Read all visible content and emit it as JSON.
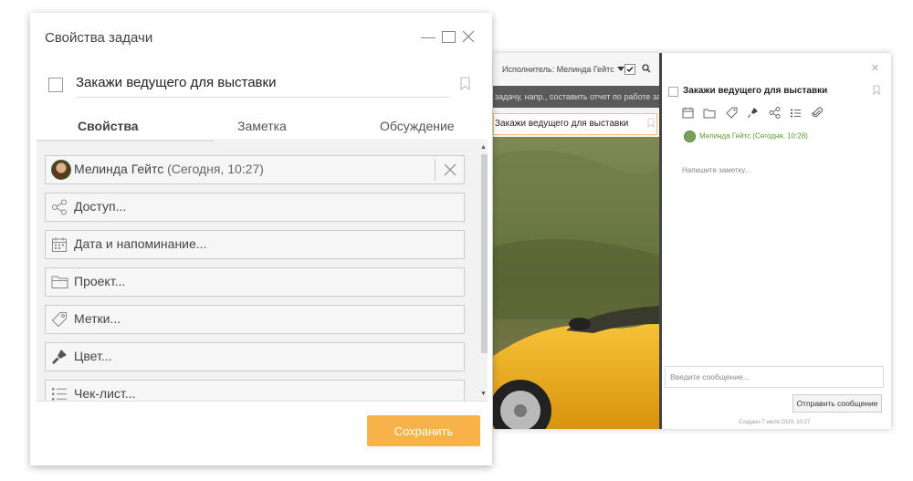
{
  "background_app": {
    "filter": {
      "assignee_label": "Исполнитель: Мелинда Гейтс"
    },
    "new_task_placeholder": "задачу, напр., составить отчет по работе за п",
    "selected_task": "Закажи ведущего для выставки",
    "detail": {
      "title": "Закажи ведущего для выставки",
      "author": "Мелинда Гейтс",
      "author_time": "(Сегодня, 10:28)",
      "note_placeholder": "Напишите заметку...",
      "message_placeholder": "Введите сообщение...",
      "send_button": "Отправить сообщение",
      "created": "Создано 7 июля 2020, 10:27"
    },
    "icons": [
      "calendar-icon",
      "folder-icon",
      "tag-icon",
      "paint-brush-icon",
      "share-icon",
      "checklist-icon",
      "paperclip-icon"
    ]
  },
  "dialog": {
    "title": "Свойства задачи",
    "task_name": "Закажи ведущего для выставки",
    "tabs": [
      {
        "label": "Свойства",
        "active": true
      },
      {
        "label": "Заметка",
        "active": false
      },
      {
        "label": "Обсуждение",
        "active": false
      }
    ],
    "owner": {
      "name": "Мелинда Гейтс",
      "time": "(Сегодня, 10:27)"
    },
    "properties": [
      {
        "label": "Доступ...",
        "icon": "share-icon"
      },
      {
        "label": "Дата и напоминание...",
        "icon": "calendar-icon"
      },
      {
        "label": "Проект...",
        "icon": "folder-icon"
      },
      {
        "label": "Метки...",
        "icon": "tag-icon"
      },
      {
        "label": "Цвет...",
        "icon": "paint-brush-icon"
      },
      {
        "label": "Чек-лист...",
        "icon": "checklist-icon"
      }
    ],
    "save_button": "Сохранить"
  },
  "colors": {
    "accent": "#f7b349",
    "author_green": "#5a9e2f",
    "selected_border": "#f0c070"
  }
}
